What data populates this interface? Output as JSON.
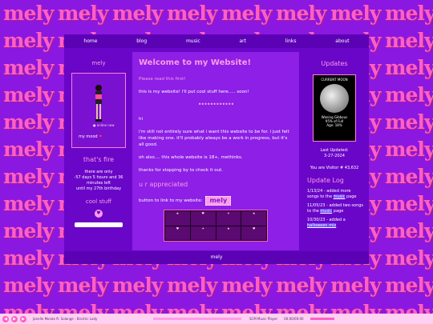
{
  "background": {
    "tile_text": "mely",
    "tile_color": "#ff5fc8",
    "bg_color": "#8a18e0"
  },
  "nav": {
    "items": [
      "home",
      "blog",
      "music",
      "art",
      "links",
      "about"
    ]
  },
  "left": {
    "title": "mely",
    "online": "online now",
    "mood_label": "my mood",
    "fire_title": "that's fire",
    "countdown": [
      "there are only",
      "-57 days 5 hours and 36",
      "minutes left",
      "until my 27th birthday"
    ],
    "cool_title": "cool stuff"
  },
  "main": {
    "title": "Welcome to my Website!",
    "read_first": "Please read this first!",
    "intro": "this is my website! i'll put cool stuff here..... soon!",
    "hi": "hi",
    "p1": "i'm still not entirely sure what i want this website to be for. i just felt like making one. it'll probably always be a work in progress, but it's all good.",
    "p2": "oh also.... this whole website is 18+, methinks.",
    "p3": "thanks for stopping by to check it out.",
    "appreciated": "u r appreciated",
    "button_text": "button to link to my website:",
    "badge": "mely"
  },
  "right": {
    "title": "Updates",
    "moon_label": "CURRENT MOON",
    "moon_phase": [
      "Waning Gibbous",
      "95% of Full",
      "Age: 18%"
    ],
    "last_updated_label": "Last Updated:",
    "last_updated": "3-27-2024",
    "visitor": "You are Visitor # 43,632",
    "log_title": "Update Log",
    "log": [
      {
        "date": "1/13/24",
        "text": " - added more songs to the ",
        "link": "music",
        "tail": " page"
      },
      {
        "date": "11/05/23",
        "text": " - added two songs to the ",
        "link": "music",
        "tail": " page"
      },
      {
        "date": "10/30/23",
        "text": " - added a ",
        "link": "halloween mix",
        "tail": ""
      }
    ]
  },
  "footer": {
    "text": "mely"
  },
  "player": {
    "track": "Janelle Monáe ft. Solange - Electric Lady",
    "name": "SCM Music Player",
    "time": "00:00/00:00",
    "progress": 0
  },
  "colors": {
    "accent": "#ff9be6",
    "panel": "#6a06c8",
    "main": "#8d1fe6"
  }
}
